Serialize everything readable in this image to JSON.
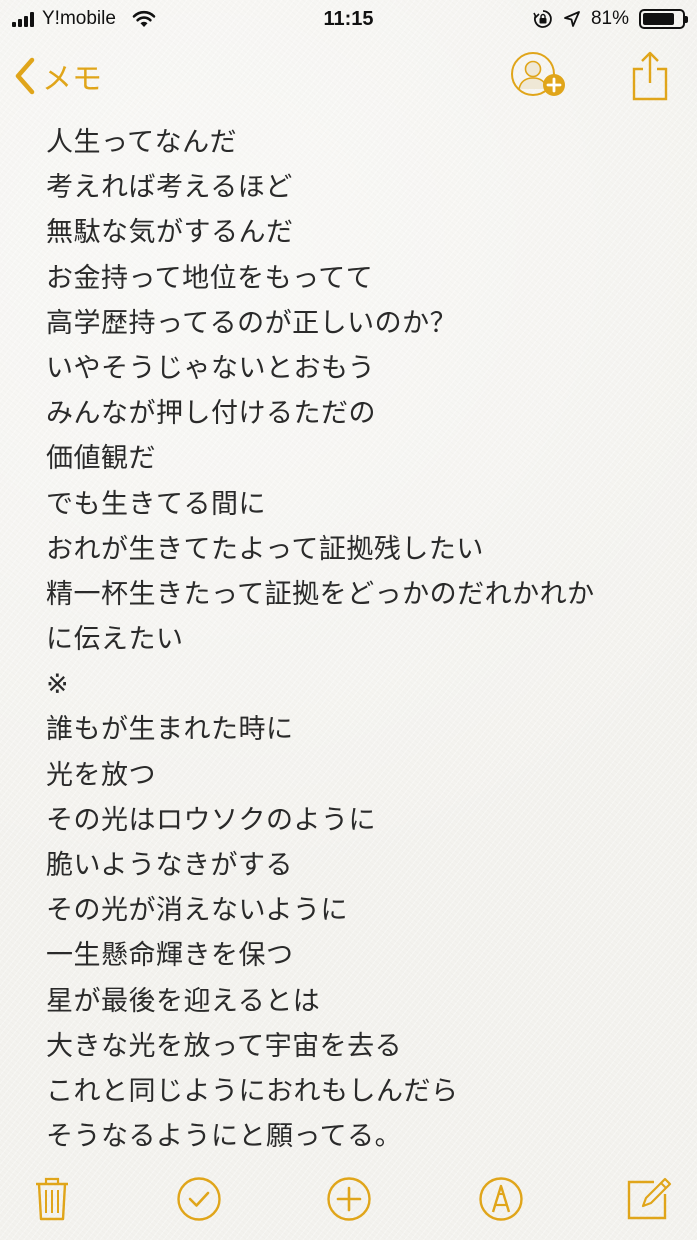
{
  "status_bar": {
    "carrier": "Y!mobile",
    "time": "11:15",
    "battery_percent": "81%",
    "battery_level": 0.81
  },
  "nav": {
    "back_label": "メモ",
    "accent_color": "#e0a51a"
  },
  "note": {
    "lines": [
      "人生ってなんだ",
      "考えれば考えるほど",
      "無駄な気がするんだ",
      "お金持って地位をもってて",
      "高学歴持ってるのが正しいのか？",
      "いやそうじゃないとおもう",
      "みんなが押し付けるただの",
      "価値観だ",
      "でも生きてる間に",
      "おれが生きてたよって証拠残したい",
      "精一杯生きたって証拠をどっかのだれかれか",
      "に伝えたい",
      "※",
      "誰もが生まれた時に",
      "光を放つ",
      "その光はロウソクのように",
      "脆いようなきがする",
      "その光が消えないように",
      "一生懸命輝きを保つ",
      "星が最後を迎えるとは",
      "大きな光を放って宇宙を去る",
      "これと同じようにおれもしんだら",
      "そうなるようにと願ってる。"
    ]
  },
  "toolbar": {
    "icons": [
      "trash-icon",
      "checklist-icon",
      "add-icon",
      "markup-icon",
      "compose-icon"
    ]
  }
}
